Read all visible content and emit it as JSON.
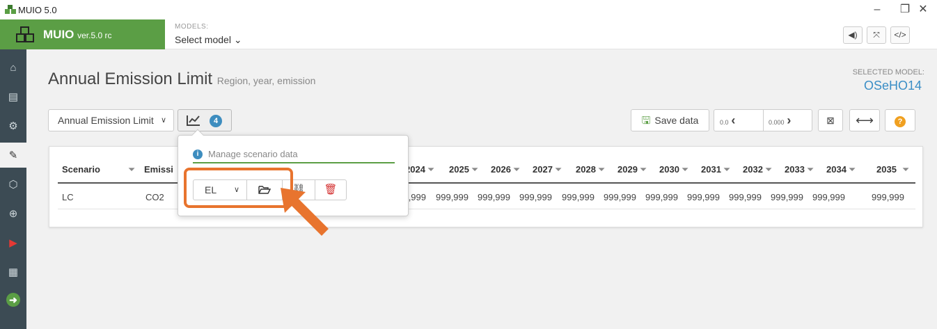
{
  "window": {
    "title": "MUIO 5.0",
    "minimize": "–",
    "restore": "❐",
    "close": "✕"
  },
  "brand": {
    "name": "MUIO",
    "version": "ver.5.0 rc"
  },
  "header": {
    "models_label": "MODELS:",
    "select_model": "Select model ⌄",
    "icons": [
      "volume-icon",
      "fullscreen-icon",
      "code-icon"
    ]
  },
  "sidenav": {
    "items": [
      "home-icon",
      "document-icon",
      "cogs-icon",
      "edit-icon",
      "cube-icon",
      "zoom-icon",
      "play-icon",
      "table-icon",
      "arrow-right-icon"
    ]
  },
  "page": {
    "title": "Annual Emission Limit",
    "subtitle": "Region, year, emission",
    "selected_model_label": "SELECTED MODEL:",
    "selected_model": "OSeHO14"
  },
  "toolbar": {
    "parameter": "Annual Emission Limit",
    "scenario_count": "4",
    "save_label": "Save data",
    "decimals_left": "0.0",
    "decimals_right": "0.000",
    "colors": {
      "accent": "#5b9e45",
      "badge": "#3d8dbf",
      "annotation": "#e8742e"
    }
  },
  "grid": {
    "col_scenario": "Scenario",
    "col_emission": "Emissi",
    "years": [
      "2024",
      "2025",
      "2026",
      "2027",
      "2028",
      "2029",
      "2030",
      "2031",
      "2032",
      "2033",
      "2034",
      "2035"
    ],
    "row": {
      "scenario": "LC",
      "emission": "CO2",
      "values": [
        "99,999",
        "999,999",
        "999,999",
        "999,999",
        "999,999",
        "999,999",
        "999,999",
        "999,999",
        "999,999",
        "999,999",
        "999,999",
        "999,999"
      ]
    }
  },
  "popover": {
    "placeholder": "Manage scenario data",
    "scenario": "EL"
  }
}
